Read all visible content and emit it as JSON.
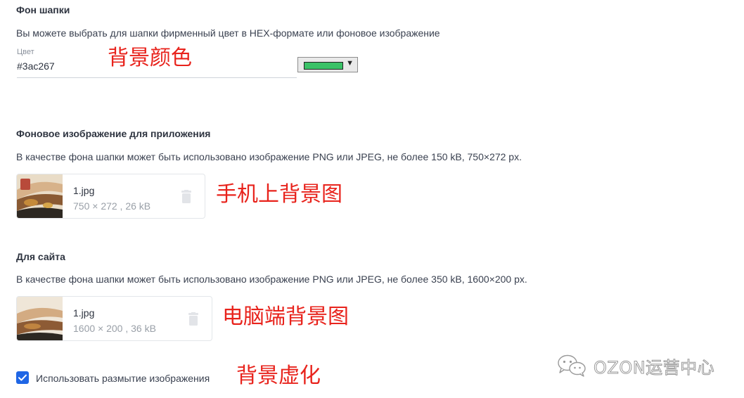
{
  "header_background": {
    "title": "Фон шапки",
    "description": "Вы можете выбрать для шапки фирменный цвет в HEX-формате или фоновое изображение",
    "color_label": "Цвет",
    "color_value": "#3ac267",
    "swatch_color": "#3ac267",
    "annotation": "背景颜色"
  },
  "app_background": {
    "title": "Фоновое изображение для приложения",
    "description": "В качестве фона шапки может быть использовано изображение PNG или JPEG, не более 150 kB, 750×272 px.",
    "file_name": "1.jpg",
    "file_meta": "750 × 272 , 26 kB",
    "annotation": "手机上背景图"
  },
  "site_background": {
    "title": "Для сайта",
    "description": "В качестве фона шапки может быть использовано изображение PNG или JPEG, не более 350 kB, 1600×200 px.",
    "file_name": "1.jpg",
    "file_meta": "1600 × 200 , 36 kB",
    "annotation": "电脑端背景图"
  },
  "blur_option": {
    "label": "Использовать размытие изображения",
    "checked": true,
    "annotation": "背景虚化"
  },
  "watermark": {
    "text": "OZON运营中心"
  },
  "icons": {
    "trash": "trash-icon",
    "check": "check-icon",
    "dropdown": "dropdown-arrow-icon",
    "wechat": "wechat-icon"
  },
  "colors": {
    "accent_blue": "#1f66e5",
    "annotation_red": "#e8231c",
    "text_dark": "#2e3440",
    "text_muted": "#9aa0a8"
  }
}
